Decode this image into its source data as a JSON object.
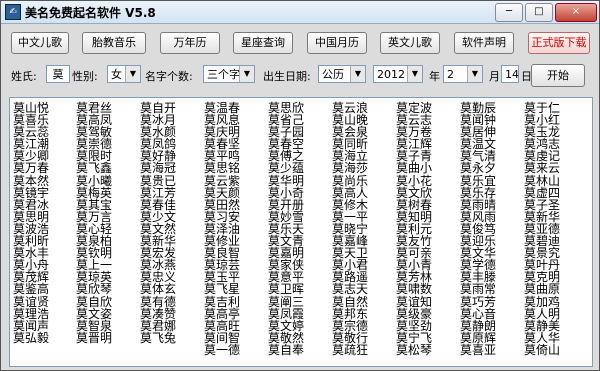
{
  "window": {
    "title": "美名免费起名软件 V5.8",
    "icon": "app-icon",
    "buttons": {
      "minimize": "─",
      "maximize": "□",
      "close": "×"
    }
  },
  "toolbar": [
    "中文儿歌",
    "胎教音乐",
    "万年历",
    "星座查询",
    "中国月历",
    "英文儿歌",
    "软件声明",
    "正式版下载"
  ],
  "form": {
    "surname_label": "姓氏:",
    "surname_value": "莫",
    "gender_label": "性别:",
    "gender_value": "女",
    "namecount_label": "名字个数:",
    "namecount_value": "三个字",
    "birth_label": "出生日期:",
    "calendar_value": "公历",
    "year_value": "2012",
    "year_label": "年",
    "month_value": "2",
    "month_label": "月",
    "day_value": "14",
    "day_label": "日",
    "start_label": "开始"
  },
  "results": [
    [
      "莫山悦",
      "莫喜乐",
      "莫云蕊",
      "莫江潮",
      "莫少卿",
      "莫万春",
      "莫本然",
      "莫镜宇",
      "莫君冰",
      "莫思明",
      "莫波浩",
      "莫利昕",
      "莫水丰",
      "莫小舟",
      "莫茂辉",
      "莫鉴高",
      "莫谊贤",
      "莫理浩",
      "莫闻声",
      "莫弘毅"
    ],
    [
      "莫君丝",
      "莫高凤",
      "莫驾敏",
      "莫崇德",
      "莫限时",
      "莫飞鑫",
      "莫小曦",
      "莫梅英",
      "莫其宝",
      "莫万言",
      "莫心轻",
      "莫泉柏",
      "莫钦明",
      "莫上一",
      "莫琼英",
      "莫欣琴",
      "莫自欣",
      "莫文姿",
      "莫智泉",
      "莫晋明"
    ],
    [
      "莫自开",
      "莫冰月",
      "莫水颜",
      "莫凤鸽",
      "莫好静",
      "莫海冠",
      "莫贵已",
      "莫江芳",
      "莫春佳",
      "莫少文",
      "莫文然",
      "莫新华",
      "莫宏发",
      "莫冰燕",
      "莫忠义",
      "莫体玄",
      "莫有德",
      "莫凑赞",
      "莫君娜",
      "莫飞兔"
    ],
    [
      "莫温春",
      "莫风息",
      "莫庆明",
      "莫春坚",
      "莫平鸣",
      "莫思铭",
      "莫云紫",
      "莫天颜",
      "莫田然",
      "莫习安",
      "莫泽油",
      "莫修业",
      "莫良智",
      "莫琼芸",
      "莫玉平",
      "莫飞星",
      "莫吉利",
      "莫高亭",
      "莫高旺",
      "莫间智",
      "莫一德"
    ],
    [
      "莫思欣",
      "莫省己",
      "莫子园",
      "莫春空",
      "莫傅之",
      "莫少蕴",
      "莫华明",
      "莫小奇",
      "莫开册",
      "莫妙雪",
      "莫乐天",
      "莫文青",
      "莫嘉明",
      "莫家侠",
      "莫意平",
      "莫卫晖",
      "莫阐三",
      "莫凤霞",
      "莫文婷",
      "莫敬然",
      "莫自奉"
    ],
    [
      "莫云浪",
      "莫山晚",
      "莫会泉",
      "莫同昕",
      "莫海立",
      "莫海莎",
      "莫尚乐",
      "莫高人",
      "莫修木",
      "莫一平",
      "莫晓宁",
      "莫嘉峰",
      "莫天卫",
      "莫小君",
      "莫路遥",
      "莫志天",
      "莫自然",
      "莫邦东",
      "莫宗德",
      "莫敬行",
      "莫疏狂"
    ],
    [
      "莫定波",
      "莫云志",
      "莫万卷",
      "莫江辉",
      "莫子青",
      "莫曲小",
      "莫小花",
      "莫文欣",
      "莫树春",
      "莫知明",
      "莫利元",
      "莫友竹",
      "莫可亲",
      "莫小青",
      "莫芳林",
      "莫啸数",
      "莫谊知",
      "莫级豪",
      "莫坚劲",
      "莫宁飞",
      "莫松琴"
    ],
    [
      "莫勤辰",
      "莫闻钟",
      "莫居伸",
      "莫温文",
      "莫气清",
      "莫永夕",
      "莫乐宜",
      "莫乐存",
      "莫雨晴",
      "莫风雨",
      "莫俊笃",
      "莫迎乐",
      "莫文华",
      "莫学德",
      "莫丰滕",
      "莫雨常",
      "莫巧芳",
      "莫心音",
      "莫静朗",
      "莫原辉",
      "莫喜亚"
    ],
    [
      "莫于仁",
      "莫小红",
      "莫玉龙",
      "莫鸿志",
      "莫虔记",
      "莫来云",
      "莫林山",
      "莫虚四",
      "莫子圣",
      "莫新华",
      "莫亚德",
      "莫碧迪",
      "莫景究",
      "莫叶丹",
      "莫克明",
      "莫曲原",
      "莫加鸡",
      "莫人明",
      "莫静美",
      "莫人华",
      "莫倚山"
    ]
  ]
}
